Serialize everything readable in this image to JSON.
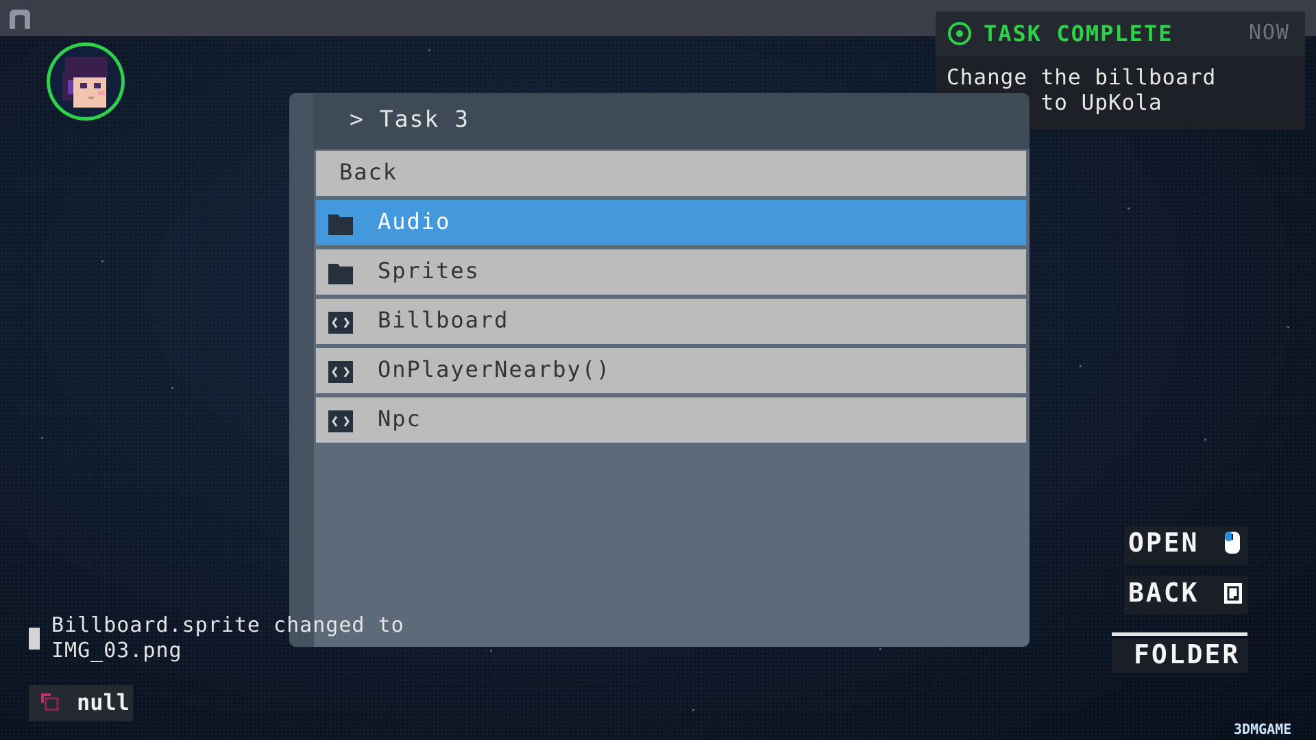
{
  "notification": {
    "title": "TASK COMPLETE",
    "time": "NOW",
    "message": "Change the billboard\nsprite to UpKola",
    "status_icon": "check-circle-icon",
    "accent_color": "#2fd04a"
  },
  "panel": {
    "title": "Task 3",
    "title_prefix": ">",
    "rows": [
      {
        "label": "Back",
        "icon": "none"
      },
      {
        "label": "Audio",
        "icon": "folder-icon",
        "selected": true
      },
      {
        "label": "Sprites",
        "icon": "folder-icon"
      },
      {
        "label": "Billboard",
        "icon": "code-icon"
      },
      {
        "label": "OnPlayerNearby()",
        "icon": "code-icon"
      },
      {
        "label": "Npc",
        "icon": "code-icon"
      }
    ],
    "selected_color": "#4499dd"
  },
  "log": {
    "message": "Billboard.sprite changed to\nIMG_03.png"
  },
  "clipboard": {
    "value": "null",
    "icon": "clipboard-icon"
  },
  "controls": {
    "open": "OPEN",
    "back": "BACK",
    "folder": "FOLDER",
    "open_icon": "mouse-icon",
    "back_icon": "key-icon"
  },
  "watermark": "3DMGAME"
}
